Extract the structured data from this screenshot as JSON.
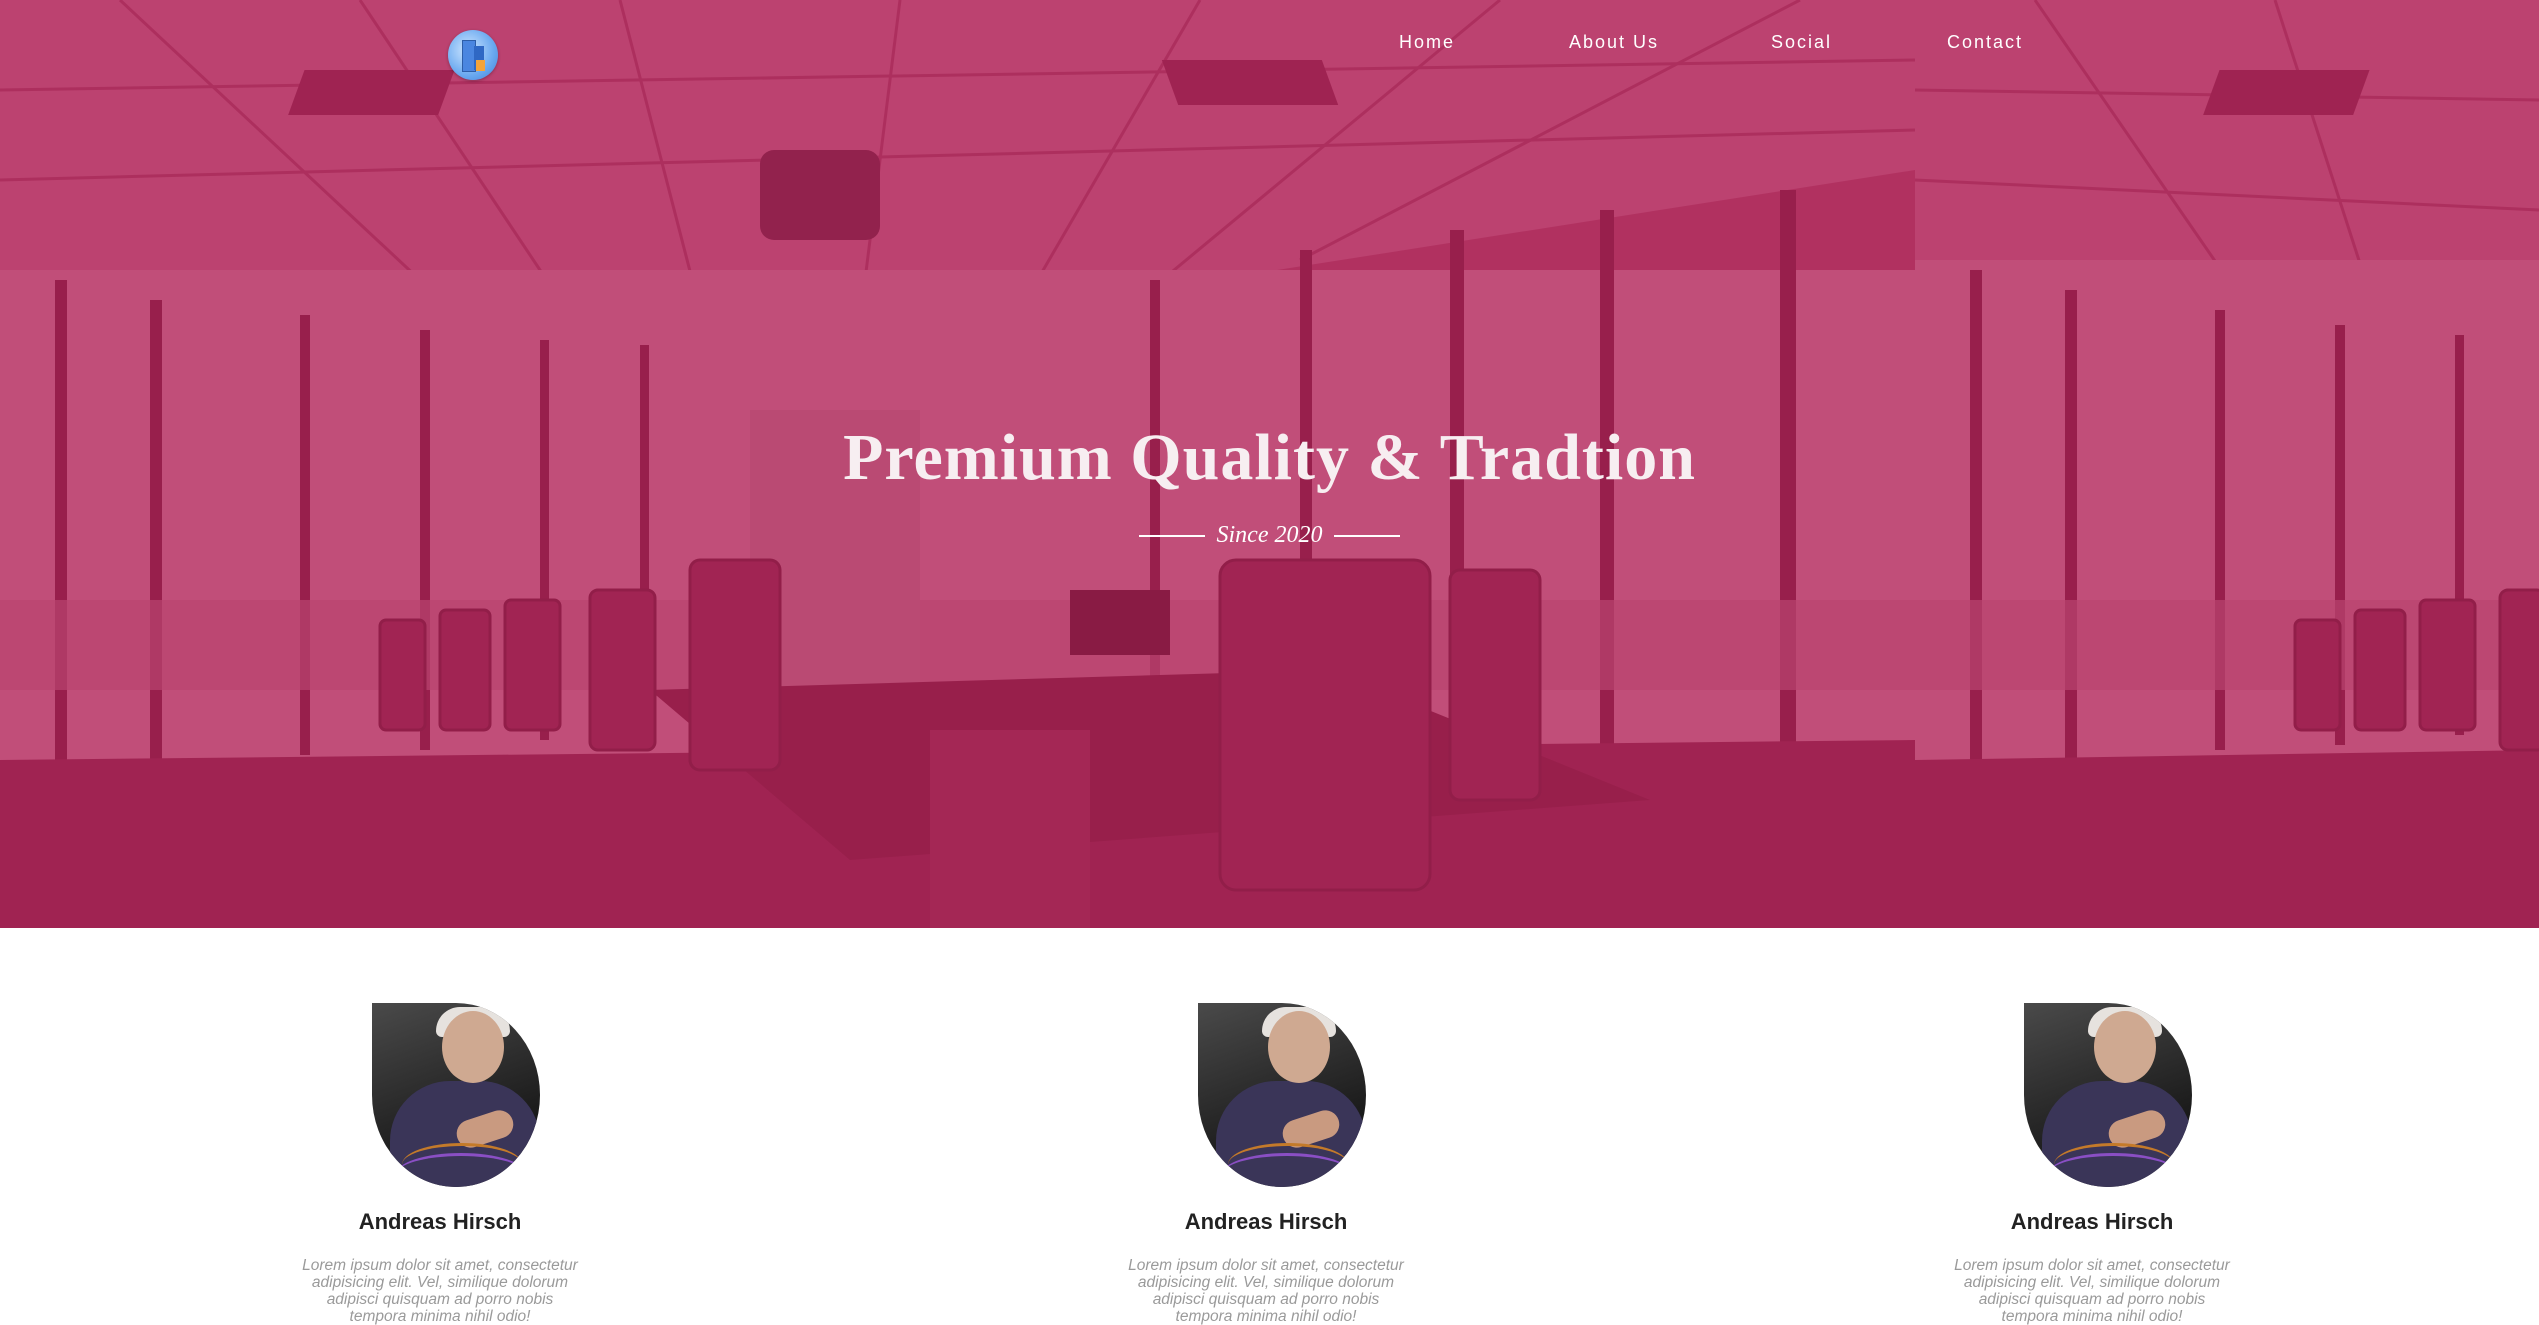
{
  "nav": {
    "logo_icon": "building-logo-icon",
    "links": [
      "Home",
      "About Us",
      "Social",
      "Contact"
    ]
  },
  "hero": {
    "title": "Premium Quality & Tradtion",
    "subtitle": "Since 2020",
    "overlay_color": "#b01e52"
  },
  "team": [
    {
      "name": "Andreas Hirsch",
      "bio": "Lorem ipsum dolor sit amet, consectetur adipisicing elit. Vel, similique dolorum adipisci quisquam ad porro nobis tempora minima nihil odio!"
    },
    {
      "name": "Andreas Hirsch",
      "bio": "Lorem ipsum dolor sit amet, consectetur adipisicing elit. Vel, similique dolorum adipisci quisquam ad porro nobis tempora minima nihil odio!"
    },
    {
      "name": "Andreas Hirsch",
      "bio": "Lorem ipsum dolor sit amet, consectetur adipisicing elit. Vel, similique dolorum adipisci quisquam ad porro nobis tempora minima nihil odio!"
    }
  ]
}
